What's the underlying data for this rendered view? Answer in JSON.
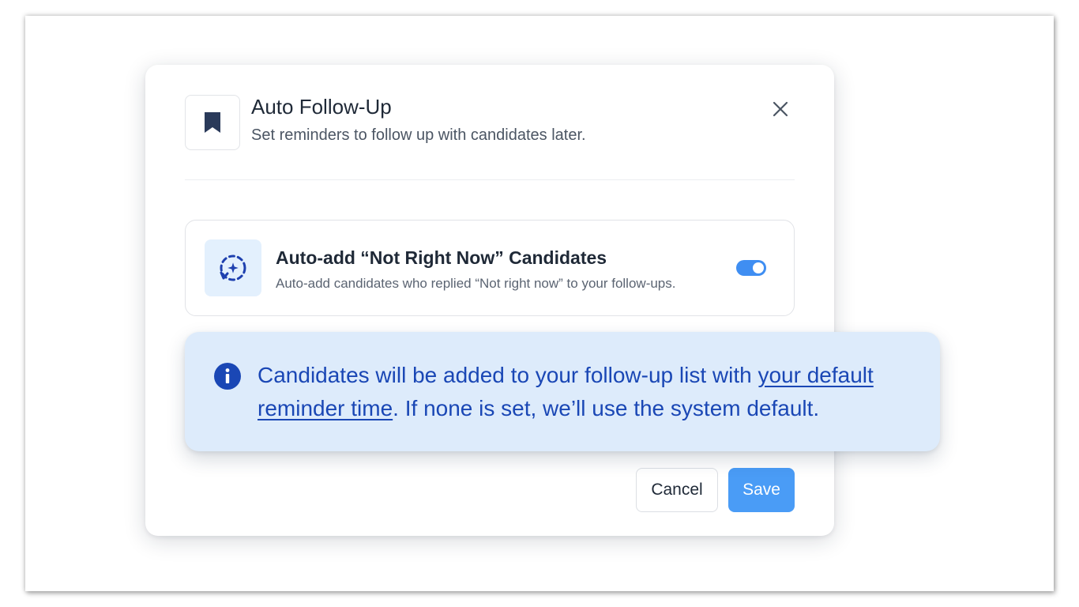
{
  "modal": {
    "title": "Auto Follow-Up",
    "subtitle": "Set reminders to follow up with candidates later.",
    "header_icon": "bookmark-icon",
    "close_icon": "close-icon"
  },
  "setting": {
    "icon": "auto-refresh-sparkle-icon",
    "title": "Auto-add “Not Right Now” Candidates",
    "description": "Auto-add candidates who replied “Not right now” to your follow-ups.",
    "toggle_on": true
  },
  "info_banner": {
    "icon": "info-icon",
    "text_before": "Candidates will be added to your follow-up list with ",
    "link_text": "your default reminder time",
    "text_after": ". If none is set, we’ll use the system default."
  },
  "buttons": {
    "cancel_label": "Cancel",
    "save_label": "Save"
  },
  "colors": {
    "accent": "#4a9cf6",
    "toggle": "#3f8ef2",
    "info_background": "#ddebfb",
    "info_text": "#1a47b5",
    "icon_dark": "#2a3a5a"
  }
}
